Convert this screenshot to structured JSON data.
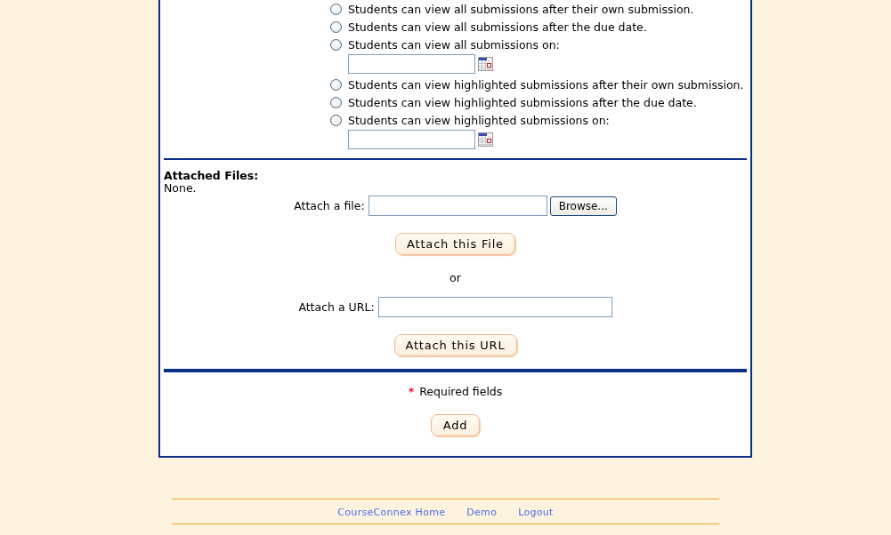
{
  "visibility_options": [
    {
      "label": "Students can view all submissions after their own submission.",
      "selected": false,
      "kind": "radio"
    },
    {
      "label": "Students can view all submissions after the due date.",
      "selected": false,
      "kind": "radio"
    },
    {
      "label": "Students can view all submissions on:",
      "selected": false,
      "kind": "radio-date"
    },
    {
      "label": "Students can view highlighted submissions after their own submission.",
      "selected": false,
      "kind": "radio"
    },
    {
      "label": "Students can view highlighted submissions after the due date.",
      "selected": false,
      "kind": "radio"
    },
    {
      "label": "Students can view highlighted submissions on:",
      "selected": false,
      "kind": "radio-date"
    }
  ],
  "attached_files": {
    "heading": "Attached Files:",
    "value": "None."
  },
  "attach_file": {
    "label": "Attach a file:",
    "browse_button": "Browse...",
    "submit_button": "Attach this File"
  },
  "divider_text": "or",
  "attach_url": {
    "label": "Attach a URL:",
    "submit_button": "Attach this URL"
  },
  "required_note": {
    "marker": "*",
    "text": "Required fields"
  },
  "submit_button": "Add",
  "footer_links": [
    "CourseConnex Home",
    "Demo",
    "Logout"
  ]
}
